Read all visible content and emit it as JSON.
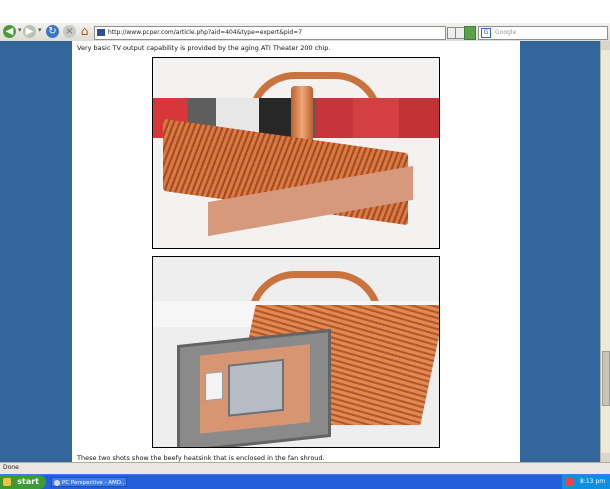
{
  "browser": {
    "url": "http://www.pcper.com/article.php?aid=404&type=expert&pid=7",
    "search_placeholder": "Google"
  },
  "page": {
    "caption_top": "Very basic TV output capability is provided by the aging ATI Theater 200 chip.",
    "caption_bottom": "These two shots show the beefy heatsink that is enclosed in the fan shroud."
  },
  "status": {
    "text": "Done"
  },
  "taskbar": {
    "start_label": "start",
    "task_label": "PC Perspective - AMD...",
    "clock": "8:13 pm"
  },
  "colors": {
    "sidebar": "#33669a",
    "taskbar": "#245edb",
    "start_button": "#3c9b34"
  }
}
